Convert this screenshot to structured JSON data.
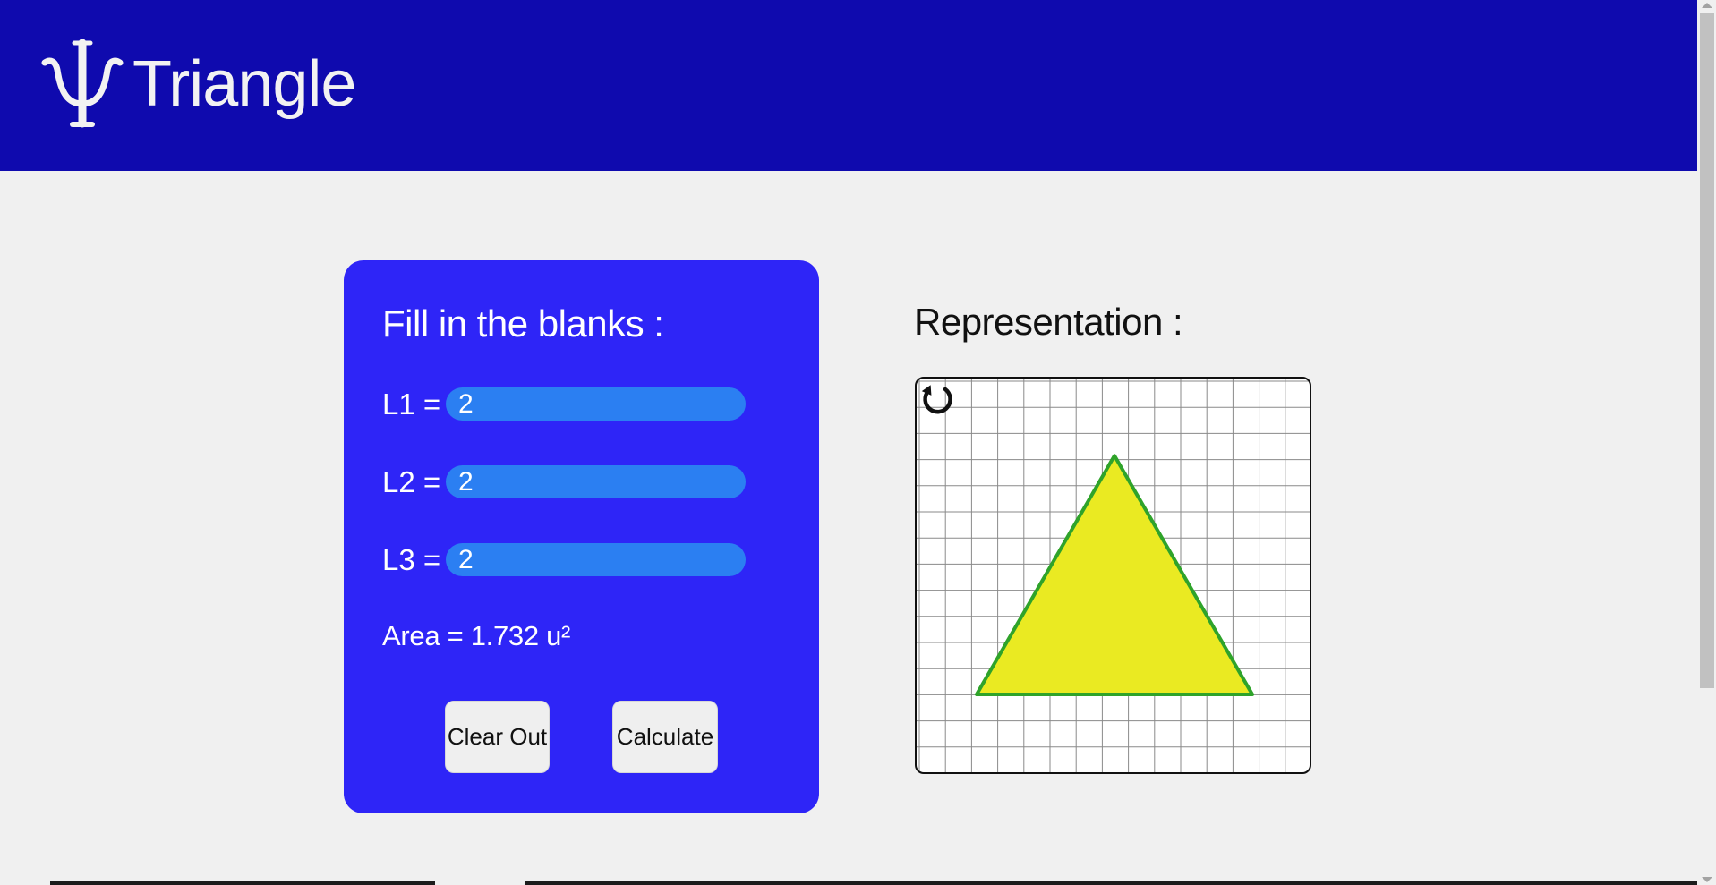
{
  "header": {
    "logo_icon": "psi-icon",
    "app_title": "Triangle",
    "background_color": "#0f0aae"
  },
  "form": {
    "title": "Fill in the blanks :",
    "fields": [
      {
        "label": "L1 =",
        "value": "2"
      },
      {
        "label": "L2 =",
        "value": "2"
      },
      {
        "label": "L3 =",
        "value": "2"
      }
    ],
    "area_text": "Area = 1.732 u²",
    "clear_button_label": "Clear Out",
    "calculate_button_label": "Calculate",
    "card_color": "#2e25f7",
    "input_color": "#2b7ff2"
  },
  "representation": {
    "title": "Representation :",
    "reset_icon": "rotate-reset-icon",
    "triangle_sides": [
      2,
      2,
      2
    ],
    "triangle_fill": "#eaea22",
    "triangle_stroke": "#2fa32a",
    "grid_color": "#8a8a8a"
  }
}
